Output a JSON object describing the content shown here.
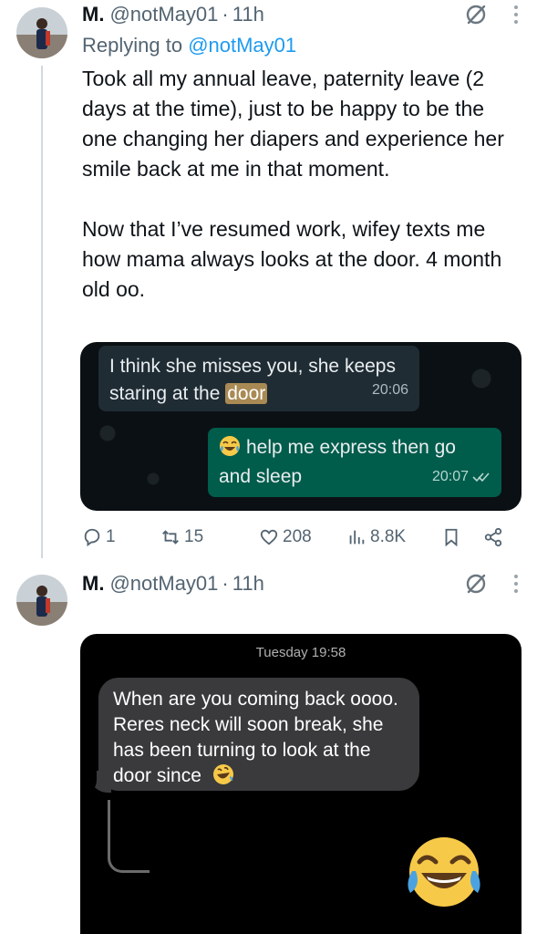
{
  "tweet1": {
    "name": "M.",
    "handle": "@notMay01",
    "dot": "·",
    "time": "11h",
    "replying_prefix": "Replying to ",
    "replying_to": "@notMay01",
    "text": "Took all my annual leave, paternity leave (2 days at the time), just to be happy to be the one changing her diapers and experience her smile back at me in that moment.\n\nNow that I’ve resumed work, wifey texts me how mama always looks at the door. 4 month old oo.",
    "whatsapp": {
      "in_text_before": "I think she misses you, she keeps staring at the ",
      "in_highlight": "door",
      "in_time": "20:06",
      "out_text": "help me express then go and sleep",
      "out_time": "20:07"
    },
    "actions": {
      "replies": "1",
      "reposts": "15",
      "likes": "208",
      "views": "8.8K"
    }
  },
  "tweet2": {
    "name": "M.",
    "handle": "@notMay01",
    "dot": "·",
    "time": "11h",
    "sms": {
      "date": "Tuesday 19:58",
      "text": "When are you coming back oooo. Reres neck will soon break, she has been turning to look at the door since"
    }
  },
  "colors": {
    "link": "#1d9bf0",
    "muted": "#536471",
    "wa_out": "#005c4b",
    "wa_in": "#1f2c34"
  }
}
